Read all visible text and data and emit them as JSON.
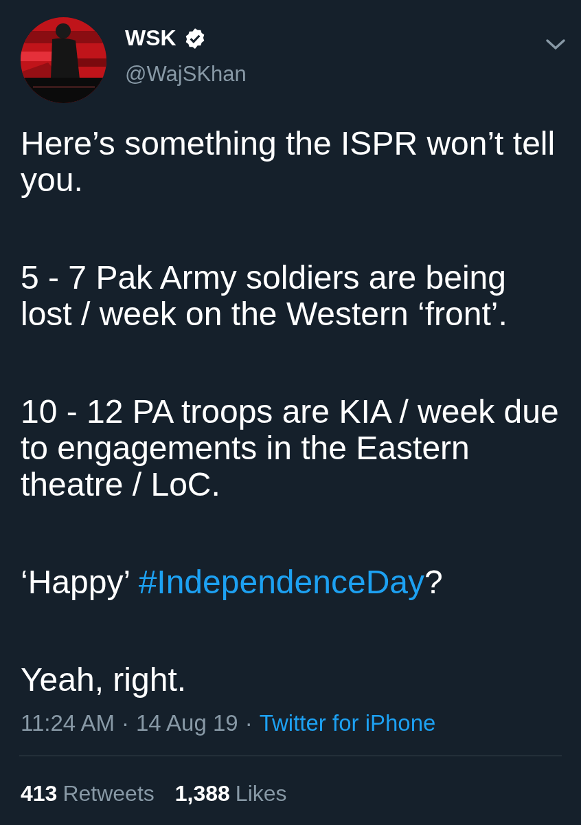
{
  "author": {
    "name": "WSK",
    "verified": true,
    "handle": "@WajSKhan"
  },
  "paragraphs": [
    [
      {
        "text": "Here’s something the ISPR won’t tell you."
      }
    ],
    [
      {
        "text": "5 - 7 Pak Army soldiers are being lost / week on the Western ‘front’."
      }
    ],
    [
      {
        "text": "10 - 12 PA troops are KIA / week due to engagements in the Eastern theatre / LoC."
      }
    ],
    [
      {
        "text": "‘Happy’ "
      },
      {
        "text": "#IndependenceDay",
        "kind": "hashtag"
      },
      {
        "text": "?"
      }
    ],
    [
      {
        "text": "Yeah, right."
      }
    ]
  ],
  "meta": [
    {
      "text": "11:24 AM",
      "kind": "time"
    },
    {
      "text": "·",
      "kind": "separator"
    },
    {
      "text": "14 Aug 19",
      "kind": "date"
    },
    {
      "text": "·",
      "kind": "separator"
    },
    {
      "text": "Twitter for iPhone",
      "kind": "link"
    }
  ],
  "stats": [
    {
      "count": "413",
      "label": "Retweets"
    },
    {
      "count": "1,388",
      "label": "Likes"
    }
  ]
}
